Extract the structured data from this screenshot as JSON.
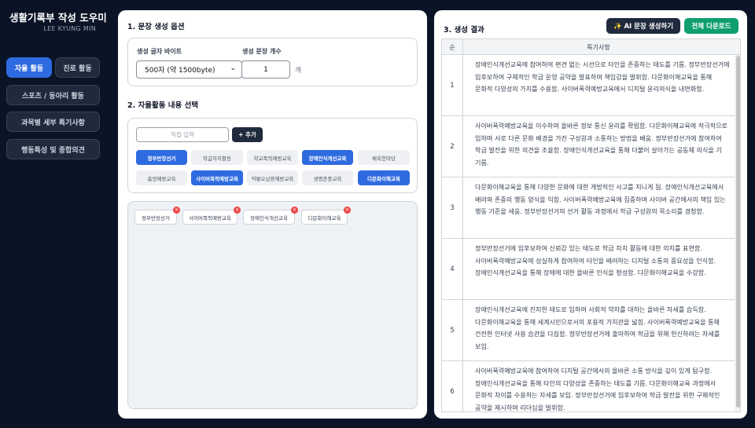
{
  "sidebar": {
    "title": "생활기록부 작성 도우미",
    "author": "LEE KYUNG MIN",
    "tabs": [
      "자율 활동",
      "진로 활동"
    ],
    "menu": [
      "스포츠 / 동아리 활동",
      "과목별 세부 특기사항",
      "행동특성 및 종합의견"
    ]
  },
  "options": {
    "section_title": "1. 문장 생성 옵션",
    "bytes_label": "생성 글자 바이트",
    "bytes_value": "500자 (약 1500byte)",
    "count_label": "생성 문장 개수",
    "count_value": "1",
    "count_unit": "개"
  },
  "activities": {
    "section_title": "2. 자율활동 내용 선택",
    "input_placeholder": "직접 입력",
    "add_label": "+ 추가",
    "chips": [
      {
        "label": "정부반장선거",
        "on": true
      },
      {
        "label": "학급자치활동",
        "on": false
      },
      {
        "label": "학교폭력예방교육",
        "on": false
      },
      {
        "label": "장애인식개선교육",
        "on": true
      },
      {
        "label": "체육한마당",
        "on": false
      },
      {
        "label": "흡연예방교육",
        "on": false
      },
      {
        "label": "사이버폭력예방교육",
        "on": true
      },
      {
        "label": "약물오남용예방교육",
        "on": false
      },
      {
        "label": "생명존중교육",
        "on": false
      },
      {
        "label": "다문화이해교육",
        "on": true
      }
    ],
    "selected": [
      "정부반장선거",
      "사이버폭력예방교육",
      "장애인식개선교육",
      "다문화이해교육"
    ]
  },
  "results": {
    "section_title": "3. 생성 결과",
    "ai_button": "✨ AI 문장 생성하기",
    "download_button": "전체 다운로드",
    "col_no": "순",
    "col_text": "특기사항",
    "rows": [
      {
        "no": "1",
        "text": "장애인식개선교육에 참여하여 편견 없는 시선으로 타인을 존중하는 태도를 기름. 정부반장선거에 입후보하여 구체적인 학급 운영 공약을 발표하며 책임감을 발휘함. 다문화이해교육을 통해 문화적 다양성의 가치를 수용함. 사이버폭력예방교육에서 디지털 윤리의식을 내면화함."
      },
      {
        "no": "2",
        "text": "사이버폭력예방교육을 이수하며 올바른 정보 통신 윤리를 확립함. 다문화이해교육에 적극적으로 임하며 서로 다른 문화 배경을 가진 구성원과 소통하는 방법을 배움. 정부반장선거에 참여하여 학급 발전을 위한 의견을 조율함. 장애인식개선교육을 통해 더불어 살아가는 공동체 의식을 기 기름."
      },
      {
        "no": "3",
        "text": "다문화이해교육을 통해 다양한 문화에 대한 개방적인 사고를 지니게 됨. 장애인식개선교육에서 배려와 존중의 행동 양식을 익힘. 사이버폭력예방교육에 집중하며 사이버 공간에서의 책임 있는 행동 기준을 세움. 정부반장선거의 선거 활동 과정에서 학급 구성원의 목소리를 경청함."
      },
      {
        "no": "4",
        "text": "정부반장선거에 입후보하여 신뢰감 있는 태도로 학급 자치 활동에 대한 의지를 표현함. 사이버폭력예방교육에 성실하게 참여하여 타인을 배려하는 디지털 소통의 중요성을 인식함. 장애인식개선교육을 통해 장애에 대한 올바른 인식을 형성함. 다문화이해교육을 수강함."
      },
      {
        "no": "5",
        "text": "장애인식개선교육에 진지한 태도로 임하며 사회적 약자를 대하는 올바른 자세를 습득함. 다문화이해교육을 통해 세계시민으로서의 포용적 가치관을 넓힘. 사이버폭력예방교육을 통해 건전한 인터넷 사용 습관을 다짐함. 정부반장선거에 출마하여 학급을 위해 헌신하려는 자세를 보임."
      },
      {
        "no": "6",
        "text": "사이버폭력예방교육에 참여하여 디지털 공간에서의 올바른 소통 방식을 깊이 있게 탐구함. 장애인식개선교육을 통해 타인의 다양성을 존중하는 태도를 기름. 다문화이해교육 과정에서 문화적 차이를 수용하는 자세를 보임. 정부반장선거에 입후보하여 학급 발전을 위한 구체적인 공약을 제시하며 리더십을 발휘함."
      }
    ]
  }
}
